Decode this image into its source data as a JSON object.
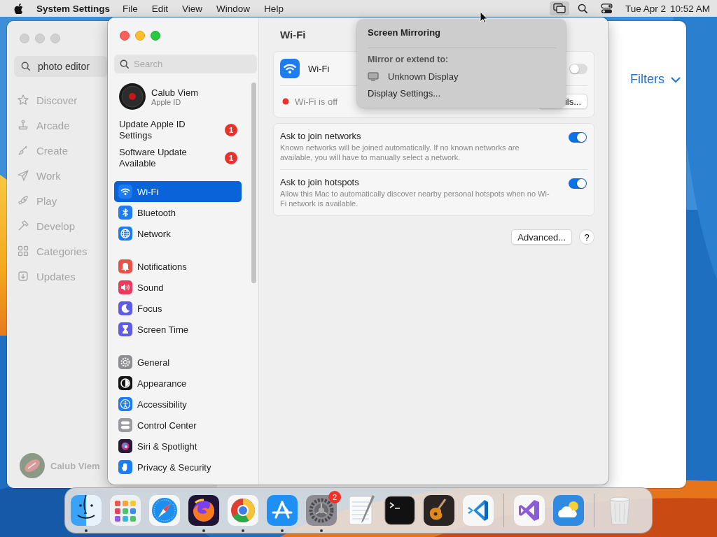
{
  "menu_bar": {
    "app_name": "System Settings",
    "menus": [
      "File",
      "Edit",
      "View",
      "Window",
      "Help"
    ],
    "date": "Tue Apr 2",
    "time": "10:52 AM"
  },
  "app_store_window": {
    "search": {
      "value": "photo editor"
    },
    "sidebar": {
      "items": [
        {
          "label": "Discover"
        },
        {
          "label": "Arcade"
        },
        {
          "label": "Create"
        },
        {
          "label": "Work"
        },
        {
          "label": "Play"
        },
        {
          "label": "Develop"
        },
        {
          "label": "Categories"
        },
        {
          "label": "Updates"
        }
      ]
    },
    "user": "Calub Viem",
    "filters": "Filters"
  },
  "settings_window": {
    "search": {
      "placeholder": "Search"
    },
    "account": {
      "name": "Calub Viem",
      "subtitle": "Apple ID"
    },
    "alerts": [
      {
        "label": "Update Apple ID Settings",
        "badge": "1"
      },
      {
        "label": "Software Update Available",
        "badge": "1"
      }
    ],
    "sidebar_groups": [
      {
        "items": [
          {
            "label": "Wi-Fi",
            "selected": true
          },
          {
            "label": "Bluetooth",
            "selected": false
          },
          {
            "label": "Network",
            "selected": false
          }
        ]
      },
      {
        "items": [
          {
            "label": "Notifications",
            "selected": false
          },
          {
            "label": "Sound",
            "selected": false
          },
          {
            "label": "Focus",
            "selected": false
          },
          {
            "label": "Screen Time",
            "selected": false
          }
        ]
      },
      {
        "items": [
          {
            "label": "General",
            "selected": false
          },
          {
            "label": "Appearance",
            "selected": false
          },
          {
            "label": "Accessibility",
            "selected": false
          },
          {
            "label": "Control Center",
            "selected": false
          },
          {
            "label": "Siri & Spotlight",
            "selected": false
          },
          {
            "label": "Privacy & Security",
            "selected": false
          }
        ]
      }
    ],
    "content": {
      "title": "Wi-Fi",
      "wifi": {
        "label": "Wi-Fi",
        "on": false,
        "status": "Wi-Fi is off",
        "details_button": "ils..."
      },
      "options": [
        {
          "title": "Ask to join networks",
          "description": "Known networks will be joined automatically. If no known networks are available, you will have to manually select a network.",
          "on": true
        },
        {
          "title": "Ask to join hotspots",
          "description": "Allow this Mac to automatically discover nearby personal hotspots when no Wi-Fi network is available.",
          "on": true
        }
      ],
      "advanced_button": "Advanced...",
      "help_button": "?"
    }
  },
  "screen_mirroring_menu": {
    "title": "Screen Mirroring",
    "section": "Mirror or extend to:",
    "displays": [
      "Unknown Display"
    ],
    "settings_item": "Display Settings..."
  },
  "dock": {
    "items": [
      {
        "running": true
      },
      {
        "running": false
      },
      {
        "running": false
      },
      {
        "running": true
      },
      {
        "running": true
      },
      {
        "running": true
      },
      {
        "running": true,
        "badge": "2"
      },
      {
        "running": false
      },
      {
        "running": false
      },
      {
        "running": false
      },
      {
        "running": false
      },
      {
        "running": false
      },
      {
        "running": false
      },
      {
        "running": false
      }
    ]
  }
}
